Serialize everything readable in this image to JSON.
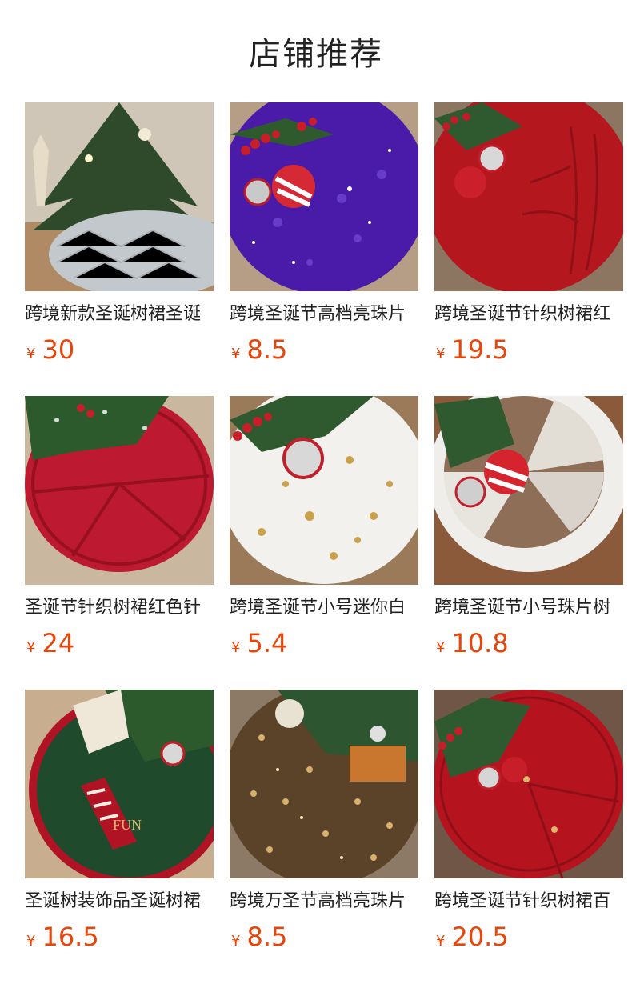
{
  "header": {
    "title": "店铺推荐"
  },
  "currency_symbol": "¥",
  "products": [
    {
      "name": "跨境新款圣诞树裙圣诞",
      "price": "30",
      "image": "tree-skirt-gray-knit"
    },
    {
      "name": "跨境圣诞节高档亮珠片",
      "price": "8.5",
      "image": "tree-skirt-purple-sequin"
    },
    {
      "name": "跨境圣诞节针织树裙红",
      "price": "19.5",
      "image": "tree-skirt-red-knit"
    },
    {
      "name": "圣诞节针织树裙红色针",
      "price": "24",
      "image": "tree-skirt-red-cable-knit"
    },
    {
      "name": "跨境圣诞节小号迷你白",
      "price": "5.4",
      "image": "tree-skirt-white-plush-snowflake"
    },
    {
      "name": "跨境圣诞节小号珠片树",
      "price": "10.8",
      "image": "tree-skirt-sequin-plush-border"
    },
    {
      "name": "圣诞树装饰品圣诞树裙",
      "price": "16.5",
      "image": "tree-skirt-green-elf-fun"
    },
    {
      "name": "跨境万圣节高档亮珠片",
      "price": "8.5",
      "image": "tree-skirt-gold-sequin-halloween"
    },
    {
      "name": "跨境圣诞节针织树裙百",
      "price": "20.5",
      "image": "tree-skirt-red-knit-buttons"
    }
  ],
  "colors": {
    "price": "#e8450b"
  }
}
